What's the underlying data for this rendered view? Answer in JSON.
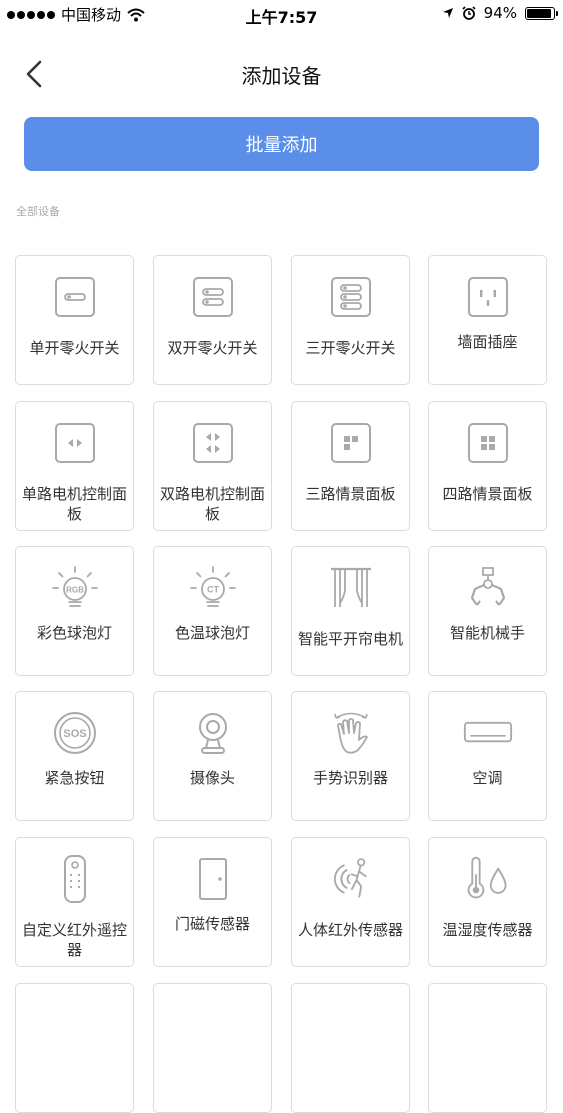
{
  "status_bar": {
    "carrier": "中国移动",
    "time": "上午7:57",
    "battery": "94%",
    "battery_level": 0.94
  },
  "nav": {
    "title": "添加设备",
    "back_icon": "chevron-left-icon"
  },
  "batch_button": {
    "label": "批量添加",
    "color": "#5a8ee8"
  },
  "section_label": "全部设备",
  "devices": [
    {
      "label": "单开零火开关",
      "icon": "single-switch-icon"
    },
    {
      "label": "双开零火开关",
      "icon": "double-switch-icon"
    },
    {
      "label": "三开零火开关",
      "icon": "triple-switch-icon"
    },
    {
      "label": "墙面插座",
      "icon": "wall-socket-icon"
    },
    {
      "label": "单路电机控制面板",
      "icon": "single-motor-panel-icon"
    },
    {
      "label": "双路电机控制面板",
      "icon": "double-motor-panel-icon"
    },
    {
      "label": "三路情景面板",
      "icon": "three-scene-panel-icon"
    },
    {
      "label": "四路情景面板",
      "icon": "four-scene-panel-icon"
    },
    {
      "label": "彩色球泡灯",
      "icon": "rgb-bulb-icon"
    },
    {
      "label": "色温球泡灯",
      "icon": "ct-bulb-icon"
    },
    {
      "label": "智能平开帘电机",
      "icon": "curtain-motor-icon"
    },
    {
      "label": "智能机械手",
      "icon": "robot-claw-icon"
    },
    {
      "label": "紧急按钮",
      "icon": "sos-button-icon"
    },
    {
      "label": "摄像头",
      "icon": "camera-icon"
    },
    {
      "label": "手势识别器",
      "icon": "gesture-icon"
    },
    {
      "label": "空调",
      "icon": "air-conditioner-icon"
    },
    {
      "label": "自定义红外遥控器",
      "icon": "ir-remote-icon"
    },
    {
      "label": "门磁传感器",
      "icon": "door-sensor-icon"
    },
    {
      "label": "人体红外传感器",
      "icon": "motion-sensor-icon"
    },
    {
      "label": "温湿度传感器",
      "icon": "temp-humidity-icon"
    }
  ]
}
